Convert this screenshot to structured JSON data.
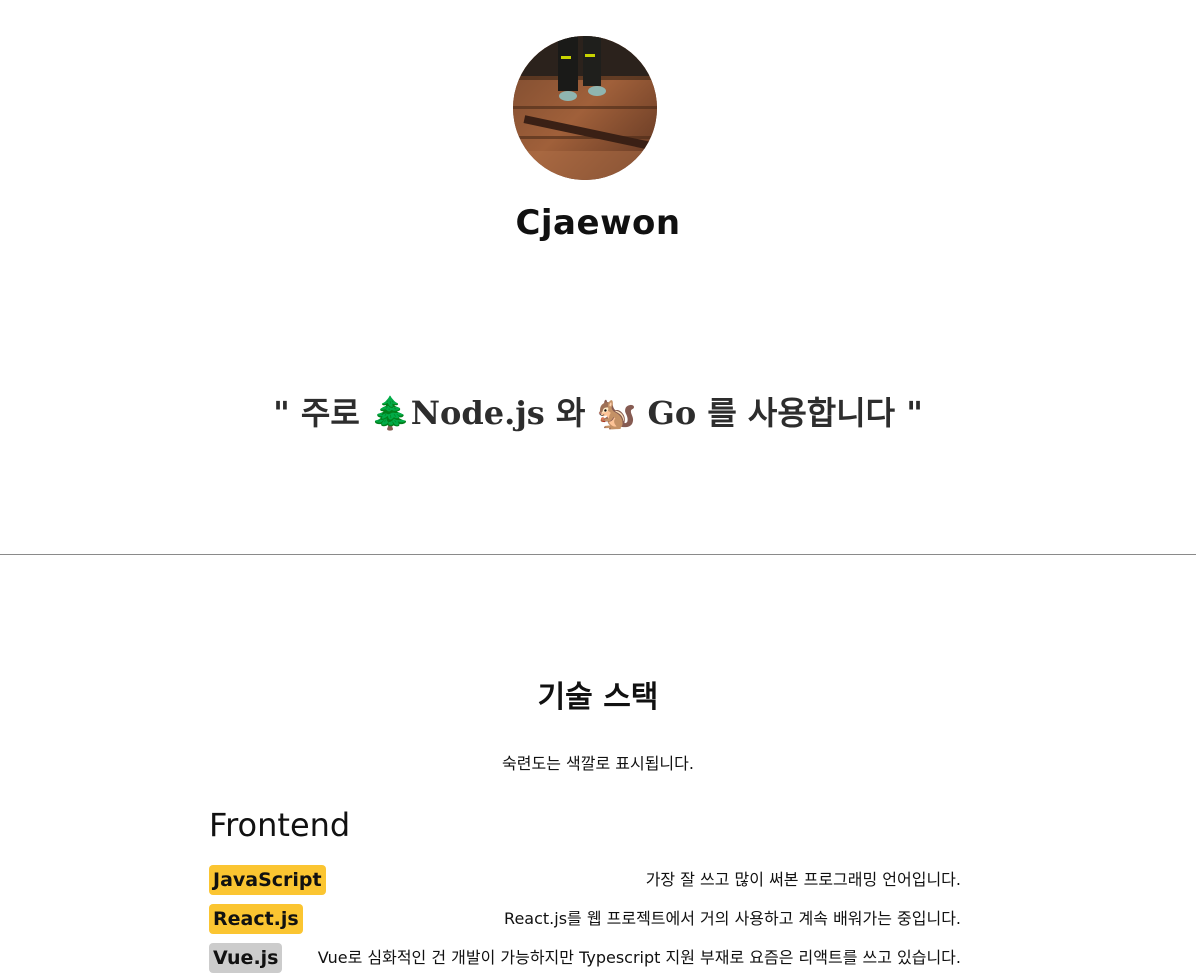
{
  "profile": {
    "name": "Cjaewon",
    "avatar_alt": "profile photo"
  },
  "quote": {
    "text": "\" 주로 🌲Node.js 와 🐿️ Go 를 사용합니다 \""
  },
  "stack": {
    "title": "기술 스택",
    "subtitle": "숙련도는 색깔로 표시됩니다.",
    "categories": [
      {
        "title": "Frontend",
        "skills": [
          {
            "name": "JavaScript",
            "level": "high",
            "color": "#fbc531",
            "desc": "가장 잘 쓰고 많이 써본 프로그래밍 언어입니다."
          },
          {
            "name": "React.js",
            "level": "high",
            "color": "#fbc531",
            "desc": "React.js를 웹 프로젝트에서 거의 사용하고 계속 배워가는 중입니다."
          },
          {
            "name": "Vue.js",
            "level": "medium",
            "color": "#cccccc",
            "desc": "Vue로 심화적인 건 개발이 가능하지만 Typescript 지원 부재로 요즘은 리액트를 쓰고 있습니다."
          }
        ]
      }
    ]
  }
}
